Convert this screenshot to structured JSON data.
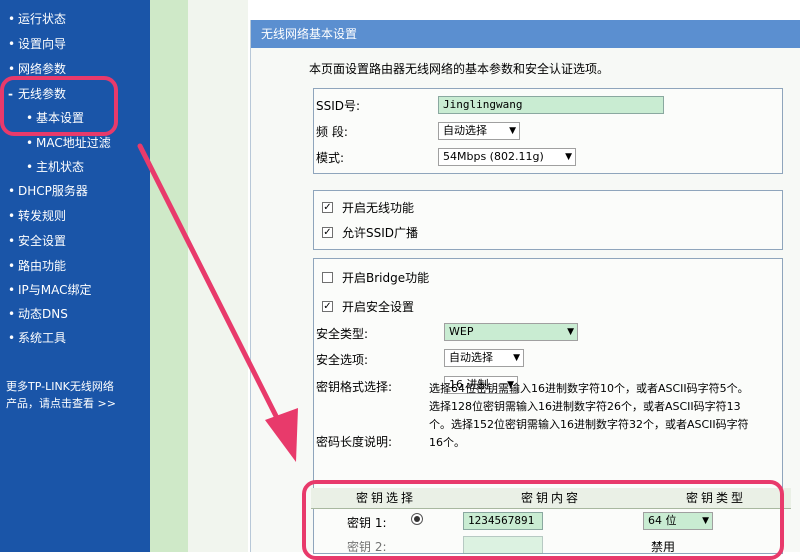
{
  "sidebar": {
    "items": [
      {
        "label": "运行状态"
      },
      {
        "label": "设置向导"
      },
      {
        "label": "网络参数"
      },
      {
        "label": "无线参数"
      },
      {
        "label": "基本设置"
      },
      {
        "label": "MAC地址过滤"
      },
      {
        "label": "主机状态"
      },
      {
        "label": "DHCP服务器"
      },
      {
        "label": "转发规则"
      },
      {
        "label": "安全设置"
      },
      {
        "label": "路由功能"
      },
      {
        "label": "IP与MAC绑定"
      },
      {
        "label": "动态DNS"
      },
      {
        "label": "系统工具"
      }
    ],
    "promo_line1": "更多TP-LINK无线网络",
    "promo_line2": "产品，请点击查看 >>"
  },
  "panel": {
    "title": "无线网络基本设置",
    "intro": "本页面设置路由器无线网络的基本参数和安全认证选项。"
  },
  "basic": {
    "ssid_label": "SSID号:",
    "ssid_value": "Jinglingwang",
    "band_label": "频  段:",
    "band_value": "自动选择",
    "mode_label": "模式:",
    "mode_value": "54Mbps (802.11g)"
  },
  "wireless": {
    "enable_label": "开启无线功能",
    "enable_checked": true,
    "ssid_broadcast_label": "允许SSID广播",
    "ssid_broadcast_checked": true
  },
  "security": {
    "bridge_label": "开启Bridge功能",
    "bridge_checked": false,
    "security_label": "开启安全设置",
    "security_checked": true,
    "type_label": "安全类型:",
    "type_value": "WEP",
    "option_label": "安全选项:",
    "option_value": "自动选择",
    "format_label": "密钥格式选择:",
    "format_value": "16 进制",
    "length_label": "密码长度说明:",
    "length_desc": "选择64位密钥需输入16进制数字符10个，或者ASCII码字符5个。选择128位密钥需输入16进制数字符26个，或者ASCII码字符13个。选择152位密钥需输入16进制数字符32个，或者ASCII码字符16个。"
  },
  "key_table": {
    "headers": [
      "密钥选择",
      "密钥内容",
      "密钥类型"
    ],
    "row1_label": "密钥 1:",
    "row1_value": "1234567891",
    "row1_type": "64 位",
    "row2_label": "密钥 2:",
    "row2_type": "禁用"
  },
  "colors": {
    "sidebar_bg": "#1a55a8",
    "header_bg": "#5b8fd0",
    "input_bg": "#c9ecd2",
    "annotation": "#e83a6b"
  }
}
